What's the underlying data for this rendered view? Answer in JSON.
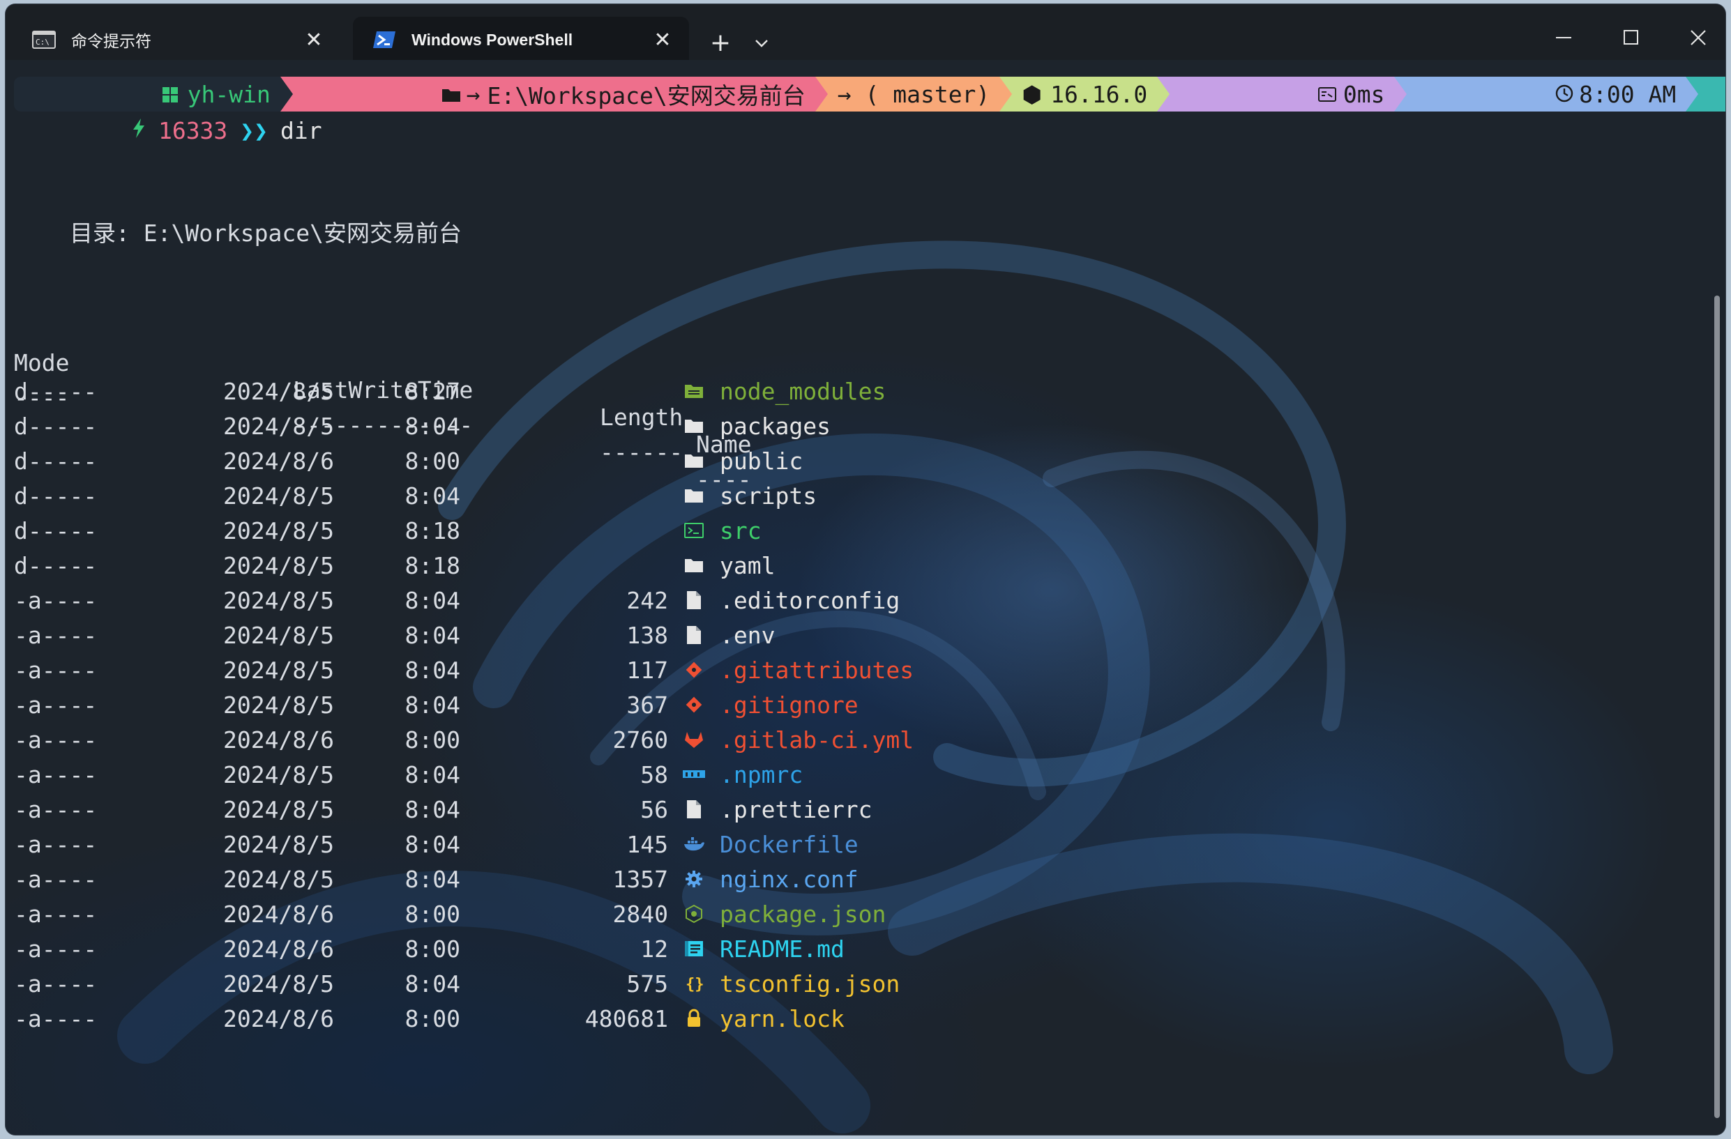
{
  "tabs": [
    {
      "label": "命令提示符",
      "icon": "cmd-icon",
      "active": false
    },
    {
      "label": "Windows PowerShell",
      "icon": "powershell-icon",
      "active": true
    }
  ],
  "titlebar": {
    "new_tab": "+"
  },
  "prompt": {
    "user": "yh-win",
    "path": "E:\\Workspace\\安网交易前台",
    "git": "→ ( master)",
    "node": "16.16.0",
    "duration": "0ms",
    "time": "8:00 AM",
    "history": "16333",
    "chevrons": "❯❯",
    "command": "dir"
  },
  "listing": {
    "dir_label": "目录: E:\\Workspace\\安网交易前台",
    "headers": [
      "Mode",
      "LastWriteTime",
      "Length",
      "Name"
    ],
    "underlines": [
      "----",
      "-------------",
      "------",
      "----"
    ],
    "rows": [
      {
        "mode": "d-----",
        "date": "2024/8/5",
        "time": "8:27",
        "length": "",
        "name": "node_modules",
        "icon": "node-modules-icon",
        "color": "#7fb03a"
      },
      {
        "mode": "d-----",
        "date": "2024/8/5",
        "time": "8:04",
        "length": "",
        "name": "packages",
        "icon": "folder-icon",
        "color": "#e6e6e6"
      },
      {
        "mode": "d-----",
        "date": "2024/8/6",
        "time": "8:00",
        "length": "",
        "name": "public",
        "icon": "folder-icon",
        "color": "#e6e6e6"
      },
      {
        "mode": "d-----",
        "date": "2024/8/5",
        "time": "8:04",
        "length": "",
        "name": "scripts",
        "icon": "folder-icon",
        "color": "#e6e6e6"
      },
      {
        "mode": "d-----",
        "date": "2024/8/5",
        "time": "8:18",
        "length": "",
        "name": "src",
        "icon": "terminal-folder-icon",
        "color": "#3ecf6a"
      },
      {
        "mode": "d-----",
        "date": "2024/8/5",
        "time": "8:18",
        "length": "",
        "name": "yaml",
        "icon": "folder-icon",
        "color": "#e6e6e6"
      },
      {
        "mode": "-a----",
        "date": "2024/8/5",
        "time": "8:04",
        "length": "242",
        "name": ".editorconfig",
        "icon": "file-icon",
        "color": "#e6e6e6"
      },
      {
        "mode": "-a----",
        "date": "2024/8/5",
        "time": "8:04",
        "length": "138",
        "name": ".env",
        "icon": "file-icon",
        "color": "#e6e6e6"
      },
      {
        "mode": "-a----",
        "date": "2024/8/5",
        "time": "8:04",
        "length": "117",
        "name": ".gitattributes",
        "icon": "git-icon",
        "color": "#f05033"
      },
      {
        "mode": "-a----",
        "date": "2024/8/5",
        "time": "8:04",
        "length": "367",
        "name": ".gitignore",
        "icon": "git-icon",
        "color": "#f05033"
      },
      {
        "mode": "-a----",
        "date": "2024/8/6",
        "time": "8:00",
        "length": "2760",
        "name": ".gitlab-ci.yml",
        "icon": "gitlab-icon",
        "color": "#f05033"
      },
      {
        "mode": "-a----",
        "date": "2024/8/5",
        "time": "8:04",
        "length": "58",
        "name": ".npmrc",
        "icon": "npm-icon",
        "color": "#2ea3e8"
      },
      {
        "mode": "-a----",
        "date": "2024/8/5",
        "time": "8:04",
        "length": "56",
        "name": ".prettierrc",
        "icon": "file-icon",
        "color": "#e6e6e6"
      },
      {
        "mode": "-a----",
        "date": "2024/8/5",
        "time": "8:04",
        "length": "145",
        "name": "Dockerfile",
        "icon": "docker-icon",
        "color": "#4a8fd8"
      },
      {
        "mode": "-a----",
        "date": "2024/8/5",
        "time": "8:04",
        "length": "1357",
        "name": "nginx.conf",
        "icon": "gear-icon",
        "color": "#5aa6f0"
      },
      {
        "mode": "-a----",
        "date": "2024/8/6",
        "time": "8:00",
        "length": "2840",
        "name": "package.json",
        "icon": "node-icon",
        "color": "#7fb03a"
      },
      {
        "mode": "-a----",
        "date": "2024/8/6",
        "time": "8:00",
        "length": "12",
        "name": "README.md",
        "icon": "readme-icon",
        "color": "#2ed3f0"
      },
      {
        "mode": "-a----",
        "date": "2024/8/5",
        "time": "8:04",
        "length": "575",
        "name": "tsconfig.json",
        "icon": "braces-icon",
        "color": "#f2c230"
      },
      {
        "mode": "-a----",
        "date": "2024/8/6",
        "time": "8:00",
        "length": "480681",
        "name": "yarn.lock",
        "icon": "lock-icon",
        "color": "#f2c230"
      }
    ]
  },
  "colors": {
    "seg_user": "#202a35",
    "seg_path": "#ee6f8c",
    "seg_git": "#f8a878",
    "seg_node": "#c8e08a",
    "seg_duration": "#c6a0e6",
    "seg_time": "#8eb2ea",
    "seg_end": "#3ab8b0"
  }
}
